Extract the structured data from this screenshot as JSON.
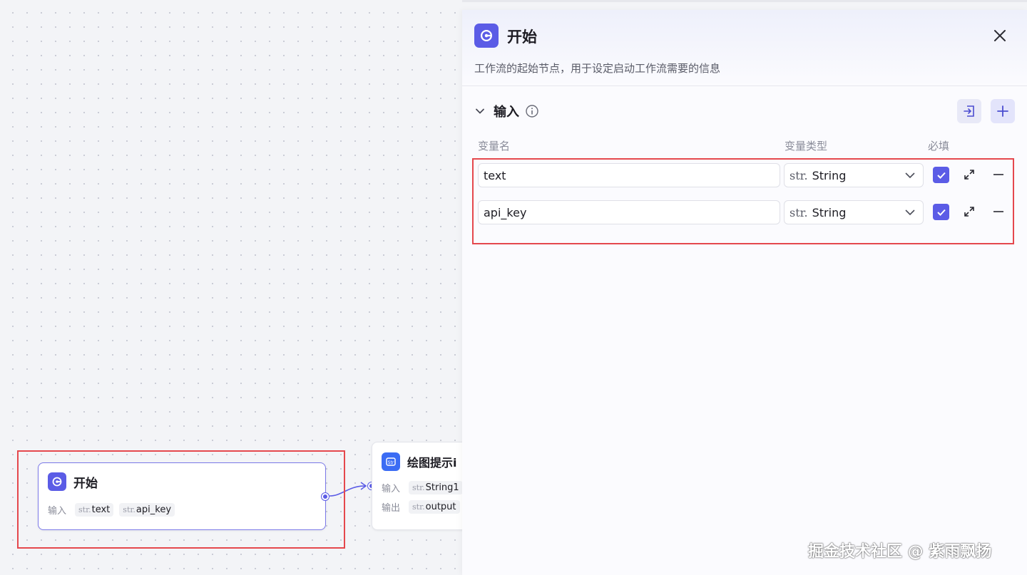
{
  "canvas": {
    "start_node": {
      "title": "开始",
      "input_label": "输入",
      "params": [
        {
          "type_prefix": "str.",
          "name": "text"
        },
        {
          "type_prefix": "str.",
          "name": "api_key"
        }
      ]
    },
    "str_node": {
      "title": "绘图提示i",
      "input_label": "输入",
      "output_label": "输出",
      "input_param": {
        "type_prefix": "str.",
        "name": "String1"
      },
      "output_param": {
        "type_prefix": "str.",
        "name": "output"
      }
    }
  },
  "panel": {
    "title": "开始",
    "description": "工作流的起始节点，用于设定启动工作流需要的信息",
    "section_title": "输入",
    "columns": {
      "name": "变量名",
      "type": "变量类型",
      "required": "必填"
    },
    "rows": [
      {
        "name": "text",
        "type_prefix": "str.",
        "type": "String",
        "required": true
      },
      {
        "name": "api_key",
        "type_prefix": "str.",
        "type": "String",
        "required": true
      }
    ]
  },
  "watermark": "掘金技术社区 @ 紫雨飘扬",
  "colors": {
    "accent": "#5b5ce6",
    "highlight": "#e5484d",
    "str_node": "#3b6cf4"
  }
}
